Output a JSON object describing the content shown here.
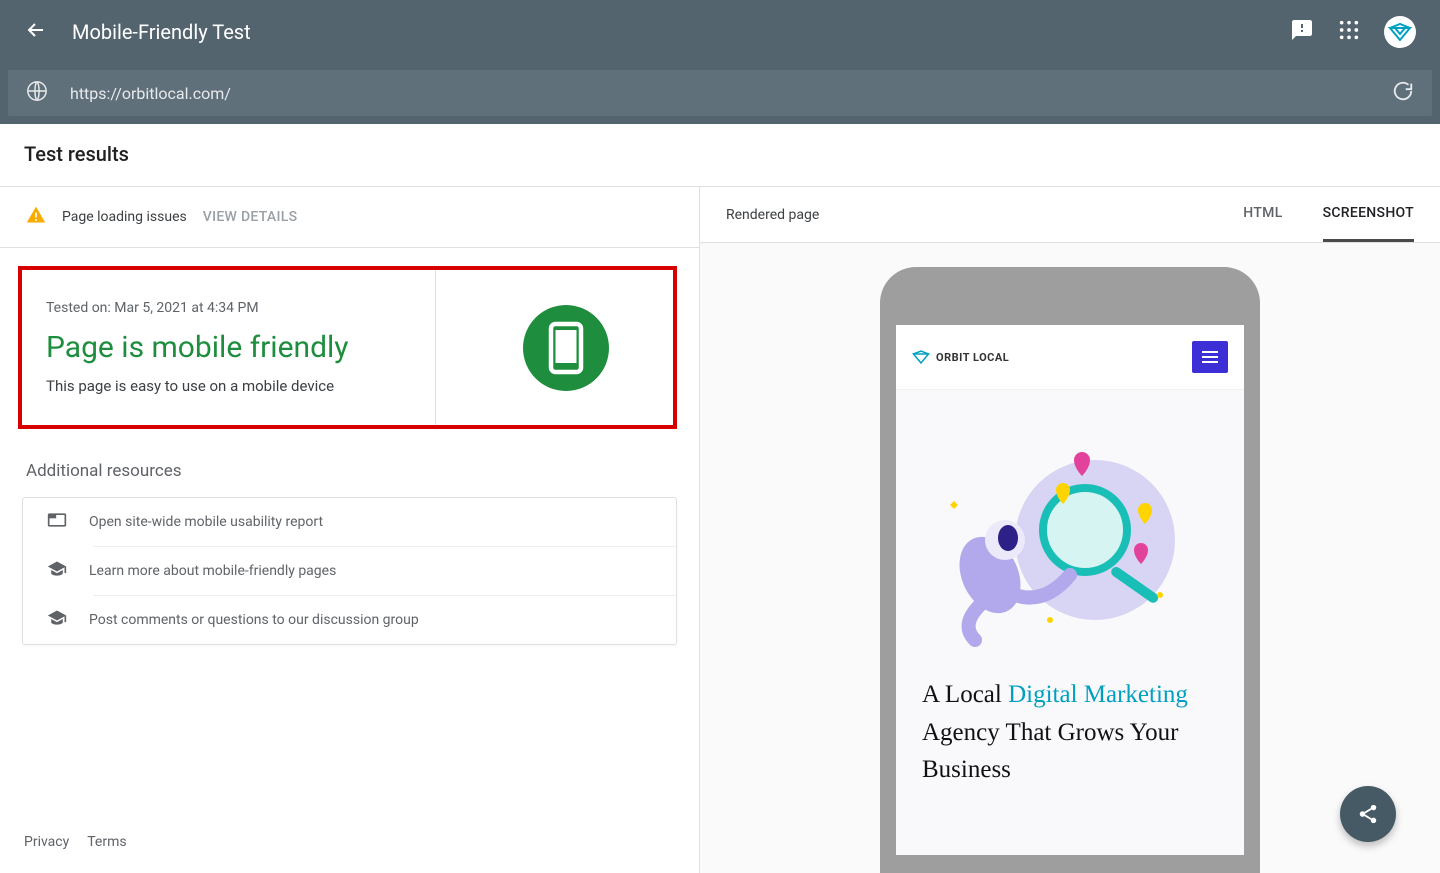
{
  "header": {
    "title": "Mobile-Friendly Test"
  },
  "urlBar": {
    "url": "https://orbitlocal.com/"
  },
  "resultsHeader": "Test results",
  "issues": {
    "text": "Page loading issues",
    "action": "VIEW DETAILS"
  },
  "result": {
    "testedOn": "Tested on: Mar 5, 2021 at 4:34 PM",
    "verdict": "Page is mobile friendly",
    "subtitle": "This page is easy to use on a mobile device"
  },
  "resources": {
    "title": "Additional resources",
    "items": [
      "Open site-wide mobile usability report",
      "Learn more about mobile-friendly pages",
      "Post comments or questions to our discussion group"
    ]
  },
  "rightPanel": {
    "label": "Rendered page",
    "tabs": {
      "html": "HTML",
      "screenshot": "SCREENSHOT"
    }
  },
  "preview": {
    "brand": "ORBIT LOCAL",
    "headline_pre": "A Local ",
    "headline_accent": "Digital Marketing",
    "headline_post": " Agency That Grows Your Business"
  },
  "footer": {
    "privacy": "Privacy",
    "terms": "Terms"
  }
}
